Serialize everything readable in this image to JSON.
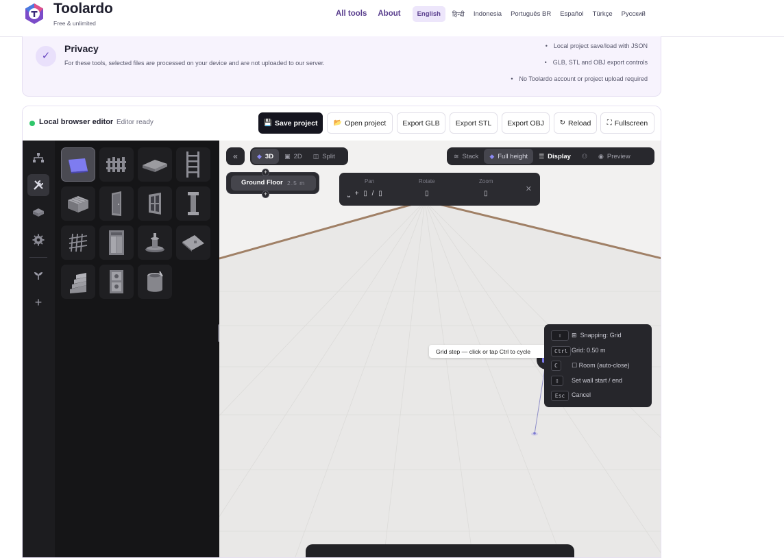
{
  "brand": {
    "name": "Toolardo",
    "tagline": "Free & unlimited"
  },
  "nav": {
    "links": [
      "All tools",
      "About"
    ],
    "languages": [
      "English",
      "हिन्दी",
      "Indonesia",
      "Português BR",
      "Español",
      "Türkçe",
      "Русский"
    ],
    "active_language": "English"
  },
  "privacy": {
    "title": "Privacy",
    "text": "For these tools, selected files are processed on your device and are not uploaded to our server.",
    "points": [
      "Local project save/load with JSON",
      "GLB, STL and OBJ export controls",
      "No Toolardo account or project upload required"
    ]
  },
  "editor": {
    "title": "Local browser editor",
    "status": "Editor ready",
    "buttons": {
      "save": "Save project",
      "open": "Open project",
      "glb": "Export GLB",
      "stl": "Export STL",
      "obj": "Export OBJ",
      "reload": "Reload",
      "fullscreen": "Fullscreen"
    }
  },
  "viewport": {
    "view_modes": [
      "3D",
      "2D",
      "Split"
    ],
    "active_view": "3D",
    "right_controls": [
      "Stack",
      "Full height",
      "Display",
      "Preview"
    ],
    "floor": {
      "name": "Ground Floor",
      "height": "2.5 m"
    },
    "nav_help": {
      "pan": "Pan",
      "rotate": "Rotate",
      "zoom": "Zoom"
    },
    "tooltip": "Grid step — click or tap Ctrl to cycle",
    "hud": {
      "snapping": "Snapping: Grid",
      "grid": "Grid: 0.50 m",
      "room": "Room (auto-close)",
      "set_wall": "Set wall start / end",
      "cancel": "Cancel",
      "keys": [
        "⇧",
        "Ctrl",
        "C",
        "Esc"
      ]
    }
  },
  "colors": {
    "accent": "#5a3f8e",
    "status": "#2fc66a",
    "dark": "#15151f"
  }
}
